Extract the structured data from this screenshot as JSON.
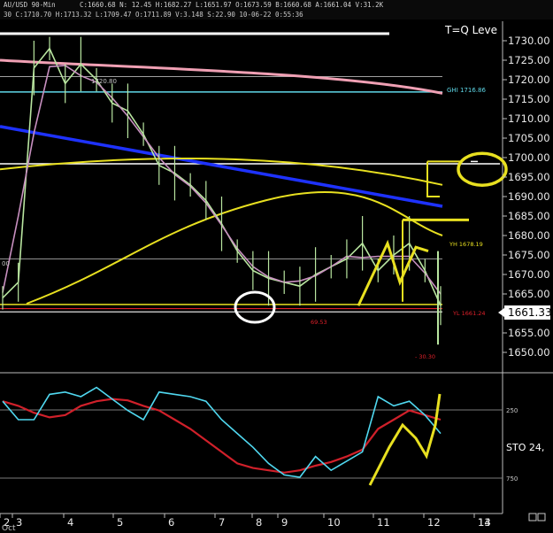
{
  "header": {
    "symbol_label": "AU/USD  90-Min",
    "info_line": "30  C:1710.70  H:1713.32  L:1709.47  O:1711.89  V:3.148  S:22.90  10-06-22  0:55:36",
    "info_line2": "C:1660.68  N:  12.45  H:1682.27  L:1651.97  O:1673.59  B:1660.68  A:1661.04  V:31.2K",
    "study_label": "T=Q Leve"
  },
  "price_panel": {
    "ylim": [
      1645,
      1735
    ],
    "yticks": [
      "1730.00",
      "1725.00",
      "1720.00",
      "1715.00",
      "1710.00",
      "1705.00",
      "1700.00",
      "1695.00",
      "1690.00",
      "1685.00",
      "1680.00",
      "1675.00",
      "1670.00",
      "1665.00",
      "1660.00",
      "1655.00",
      "1650.00"
    ],
    "current_price": "1661.33",
    "annotations": {
      "level_1720": "1720.80",
      "ghi": "GHI 1716.86",
      "yh": "YH 1678.19",
      "yl": "YL 1661.24",
      "red_low": "69.53",
      "red_bottom": "- 30.30",
      "left_stub": "00"
    }
  },
  "stoch_panel": {
    "label": "STO  24,",
    "levels": [
      "250",
      "750"
    ]
  },
  "x_axis": {
    "labels": [
      "2",
      "3",
      "4",
      "5",
      "6",
      "7",
      "8",
      "9",
      "10",
      "11",
      "12",
      "13",
      "14"
    ],
    "bottom_label": "Oct"
  },
  "colors": {
    "background": "#000000",
    "price_line": "#b9e6a0",
    "pink_ma": "#f0a0b4",
    "cyan_level": "#5fd8e8",
    "blue_trend": "#1e32ff",
    "yellow": "#e8e020",
    "stoch_fast": "#50d8f0",
    "stoch_slow": "#d0202a"
  },
  "chart_data": {
    "type": "line",
    "title": "",
    "xlabel": "",
    "ylabel": "",
    "ylim": [
      1645,
      1735
    ],
    "x": [
      "2",
      "3",
      "4",
      "5",
      "6",
      "7",
      "8",
      "9",
      "10",
      "11",
      "12",
      "13"
    ],
    "series": [
      {
        "values": [
          1664,
          1668,
          1723,
          1728,
          1719,
          1724,
          1720,
          1714,
          1712,
          1706,
          1698,
          1696,
          1693,
          1689,
          1683,
          1676,
          1671,
          1669,
          1668,
          1667,
          1670,
          1672,
          1674,
          1678,
          1671,
          1675,
          1678,
          1671,
          1662
        ]
      }
    ],
    "levels": [
      {
        "value": 1720.8,
        "label": "1720.80"
      },
      {
        "value": 1716.86,
        "label": "GHI 1716.86"
      },
      {
        "value": 1678.19,
        "label": "YH 1678.19"
      },
      {
        "value": 1661.24,
        "label": "YL 1661.24"
      }
    ],
    "last_price": 1661.33,
    "stochastic": {
      "label": "STO",
      "fast": [
        260,
        300,
        300,
        245,
        240,
        250,
        230,
        255,
        280,
        300,
        240,
        245,
        250,
        260,
        300,
        330,
        360,
        395,
        420,
        425,
        380,
        410,
        390,
        370,
        250,
        270,
        260,
        290,
        330
      ],
      "slow": [
        260,
        270,
        285,
        295,
        290,
        270,
        260,
        255,
        258,
        270,
        280,
        300,
        320,
        345,
        370,
        395,
        405,
        410,
        415,
        410,
        400,
        392,
        380,
        365,
        320,
        300,
        280,
        290,
        300
      ]
    }
  }
}
